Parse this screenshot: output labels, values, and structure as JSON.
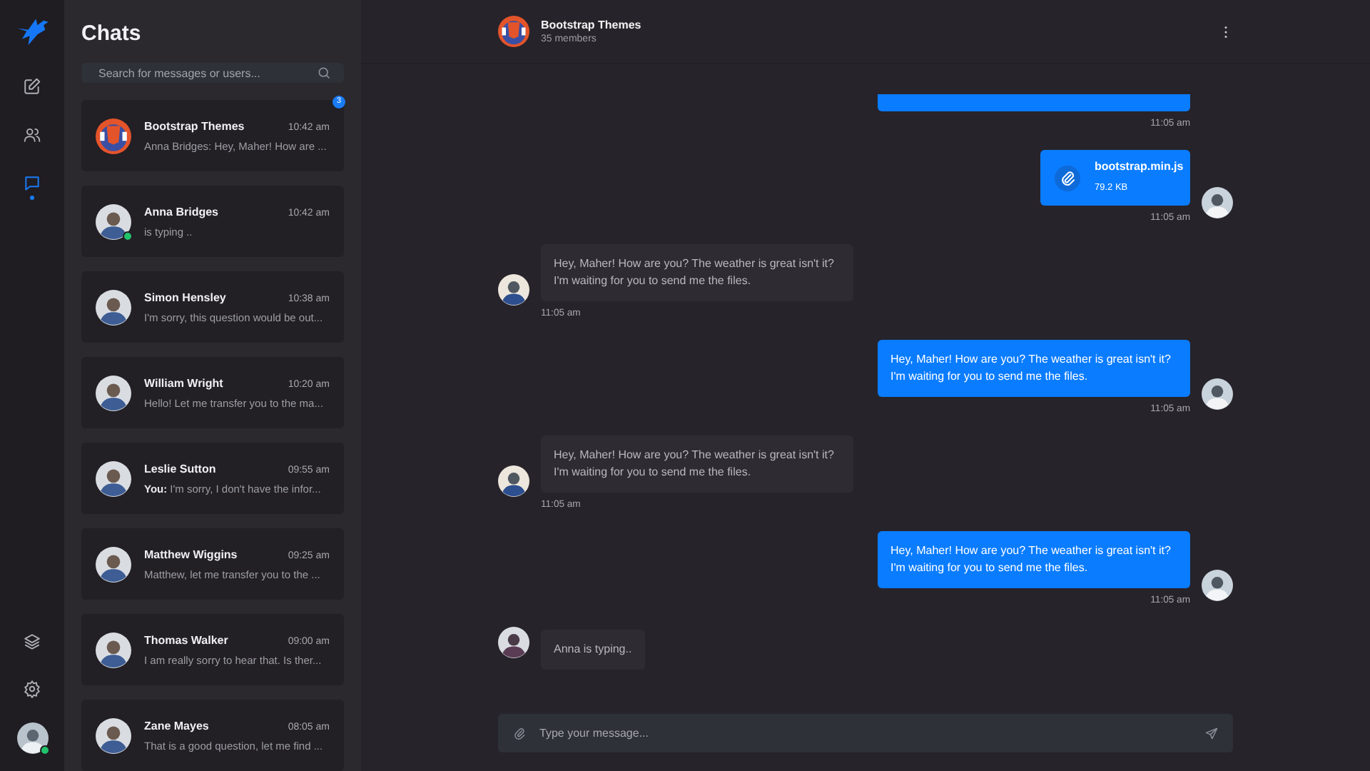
{
  "nav": {
    "items": [
      {
        "kind": "compose",
        "selected": false
      },
      {
        "kind": "contacts",
        "selected": false
      },
      {
        "kind": "chat",
        "selected": true
      }
    ],
    "bottom_items": [
      {
        "kind": "layers"
      },
      {
        "kind": "settings"
      }
    ],
    "user_online": true
  },
  "chats_panel": {
    "title": "Chats",
    "search": {
      "placeholder": "Search for messages or users..."
    },
    "items": [
      {
        "kind": "group",
        "name": "Bootstrap Themes",
        "time": "10:42 am",
        "preview": "Anna Bridges: Hey, Maher! How are ...",
        "online": false,
        "badge": "3"
      },
      {
        "kind": "person",
        "name": "Anna Bridges",
        "time": "10:42 am",
        "preview": "is typing ..",
        "online": true
      },
      {
        "kind": "person",
        "name": "Simon Hensley",
        "time": "10:38 am",
        "preview": "I'm sorry, this question would be out...",
        "online": false
      },
      {
        "kind": "person",
        "name": "William Wright",
        "time": "10:20 am",
        "preview": "Hello! Let me transfer you to the ma...",
        "online": false
      },
      {
        "kind": "person",
        "name": "Leslie Sutton",
        "time": "09:55 am",
        "preview_prefix": "You:",
        "preview": "I'm sorry, I don't have the infor...",
        "online": false
      },
      {
        "kind": "person",
        "name": "Matthew Wiggins",
        "time": "09:25 am",
        "preview": "Matthew, let me transfer you to the ...",
        "online": false
      },
      {
        "kind": "person",
        "name": "Thomas Walker",
        "time": "09:00 am",
        "preview": "I am really sorry to hear that. Is ther...",
        "online": false
      },
      {
        "kind": "person",
        "name": "Zane Mayes",
        "time": "08:05 am",
        "preview": "That is a good question, let me find ...",
        "online": false
      }
    ]
  },
  "conversation": {
    "title": "Bootstrap Themes",
    "subtitle": "35 members",
    "messages": [
      {
        "kind": "clipped",
        "time": "11:05 am"
      },
      {
        "kind": "file",
        "file_name": "bootstrap.min.js",
        "file_size": "79.2 KB",
        "time": "11:05 am"
      },
      {
        "kind": "incoming",
        "text": "Hey, Maher! How are you? The weather is great isn't it?\nI'm waiting for you to send me the files.",
        "time": "11:05 am"
      },
      {
        "kind": "outgoing",
        "text": "Hey, Maher! How are you? The weather is great isn't it?\nI'm waiting for you to send me the files.",
        "time": "11:05 am"
      },
      {
        "kind": "incoming",
        "text": "Hey, Maher! How are you? The weather is great isn't it?\nI'm waiting for you to send me the files.",
        "time": "11:05 am"
      },
      {
        "kind": "outgoing",
        "text": "Hey, Maher! How are you? The weather is great isn't it?\nI'm waiting for you to send me the files.",
        "time": "11:05 am"
      },
      {
        "kind": "typing",
        "text": "Anna is typing.."
      }
    ],
    "composer": {
      "placeholder": "Type your message..."
    }
  }
}
